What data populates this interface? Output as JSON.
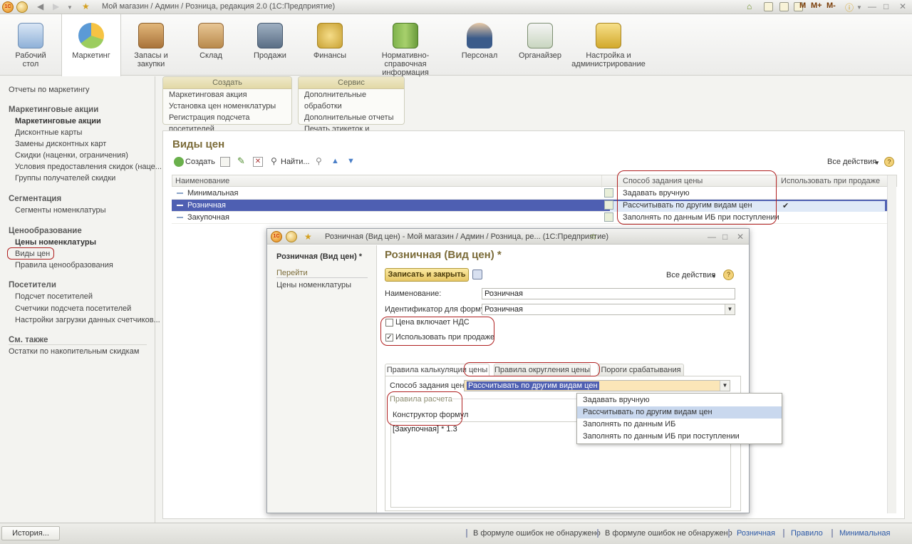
{
  "window": {
    "title": "Мой магазин / Админ / Розница, редакция 2.0  (1С:Предприятие)",
    "toolbar_letters": [
      "M",
      "M+",
      "M-"
    ]
  },
  "ribbon": {
    "items": [
      {
        "label": "Рабочий стол",
        "icon": "desktop-icon"
      },
      {
        "label": "Маркетинг",
        "icon": "pie-chart-icon"
      },
      {
        "label": "Запасы и закупки",
        "icon": "boxes-icon"
      },
      {
        "label": "Склад",
        "icon": "warehouse-icon"
      },
      {
        "label": "Продажи",
        "icon": "cash-register-icon"
      },
      {
        "label": "Финансы",
        "icon": "coins-icon"
      },
      {
        "label": "Нормативно-справочная информация",
        "icon": "binders-icon"
      },
      {
        "label": "Персонал",
        "icon": "person-icon"
      },
      {
        "label": "Органайзер",
        "icon": "clipboard-icon"
      },
      {
        "label": "Настройка и администрирование",
        "icon": "database-icon"
      }
    ]
  },
  "leftnav": {
    "reports": "Отчеты по маркетингу",
    "groups": [
      {
        "title": "Маркетинговые акции",
        "items": [
          "Маркетинговые акции",
          "Дисконтные карты",
          "Замены дисконтных карт",
          "Скидки (наценки, ограничения)",
          "Условия предоставления скидок (наце...",
          "Группы получателей скидки"
        ]
      },
      {
        "title": "Сегментация",
        "items": [
          "Сегменты номенклатуры"
        ]
      },
      {
        "title": "Ценообразование",
        "items": [
          "Цены номенклатуры",
          "Виды цен",
          "Правила ценообразования"
        ]
      },
      {
        "title": "Посетители",
        "items": [
          "Подсчет посетителей",
          "Счетчики подсчета посетителей",
          "Настройки загрузки данных счетчиков..."
        ]
      },
      {
        "title": "См. также",
        "items": [
          "Остатки по накопительным скидкам"
        ]
      }
    ]
  },
  "commands": {
    "create": {
      "title": "Создать",
      "items": [
        "Маркетинговая акция",
        "Установка цен номенклатуры",
        "Регистрация подсчета посетителей"
      ]
    },
    "service": {
      "title": "Сервис",
      "items": [
        "Дополнительные обработки",
        "Дополнительные отчеты",
        "Печать этикеток и ценников"
      ]
    }
  },
  "list": {
    "title": "Виды цен",
    "toolbar": {
      "create": "Создать",
      "find": "Найти...",
      "all_actions": "Все действия"
    },
    "columns": [
      "Наименование",
      "Способ задания цены",
      "Использовать при продаже"
    ],
    "rows": [
      {
        "name": "Минимальная",
        "way": "Задавать вручную",
        "use": ""
      },
      {
        "name": "Розничная",
        "way": "Рассчитывать по другим видам цен",
        "use": "✔"
      },
      {
        "name": "Закупочная",
        "way": "Заполнять по данным ИБ при поступлении",
        "use": ""
      }
    ]
  },
  "modal": {
    "title": "Розничная (Вид цен) - Мой магазин / Админ / Розница, ре...  (1С:Предприятие)",
    "nav_title": "Розничная (Вид цен) *",
    "nav_goto": "Перейти",
    "nav_link": "Цены номенклатуры",
    "heading": "Розничная (Вид цен) *",
    "save_close": "Записать и закрыть",
    "all_actions": "Все действия",
    "name_label": "Наименование:",
    "name_value": "Розничная",
    "formula_id_label": "Идентификатор для формул:",
    "formula_id_value": "Розничная",
    "vat_label": "Цена включает НДС",
    "vat_checked": false,
    "use_sale_label": "Использовать при продаже",
    "use_sale_checked": true,
    "tabs": [
      "Правила калькуляции цены",
      "Правила округления цены",
      "Пороги срабатывания"
    ],
    "method_label": "Способ задания цены:",
    "method_value": "Рассчитывать по другим видам цен",
    "calc_rules_label": "Правила расчета",
    "constructor_label": "Конструктор формул",
    "formula": "[Закупочная]  * 1.3",
    "dropdown_options": [
      "Задавать вручную",
      "Рассчитывать по другим видам цен",
      "Заполнять по данным ИБ",
      "Заполнять по данным ИБ при поступлении"
    ],
    "dropdown_selected": 1
  },
  "status": {
    "history": "История...",
    "items": [
      "В формуле ошибок не обнаружено",
      "В формуле ошибок не обнаружено",
      "Розничная",
      "Правило",
      "Минимальная"
    ]
  }
}
